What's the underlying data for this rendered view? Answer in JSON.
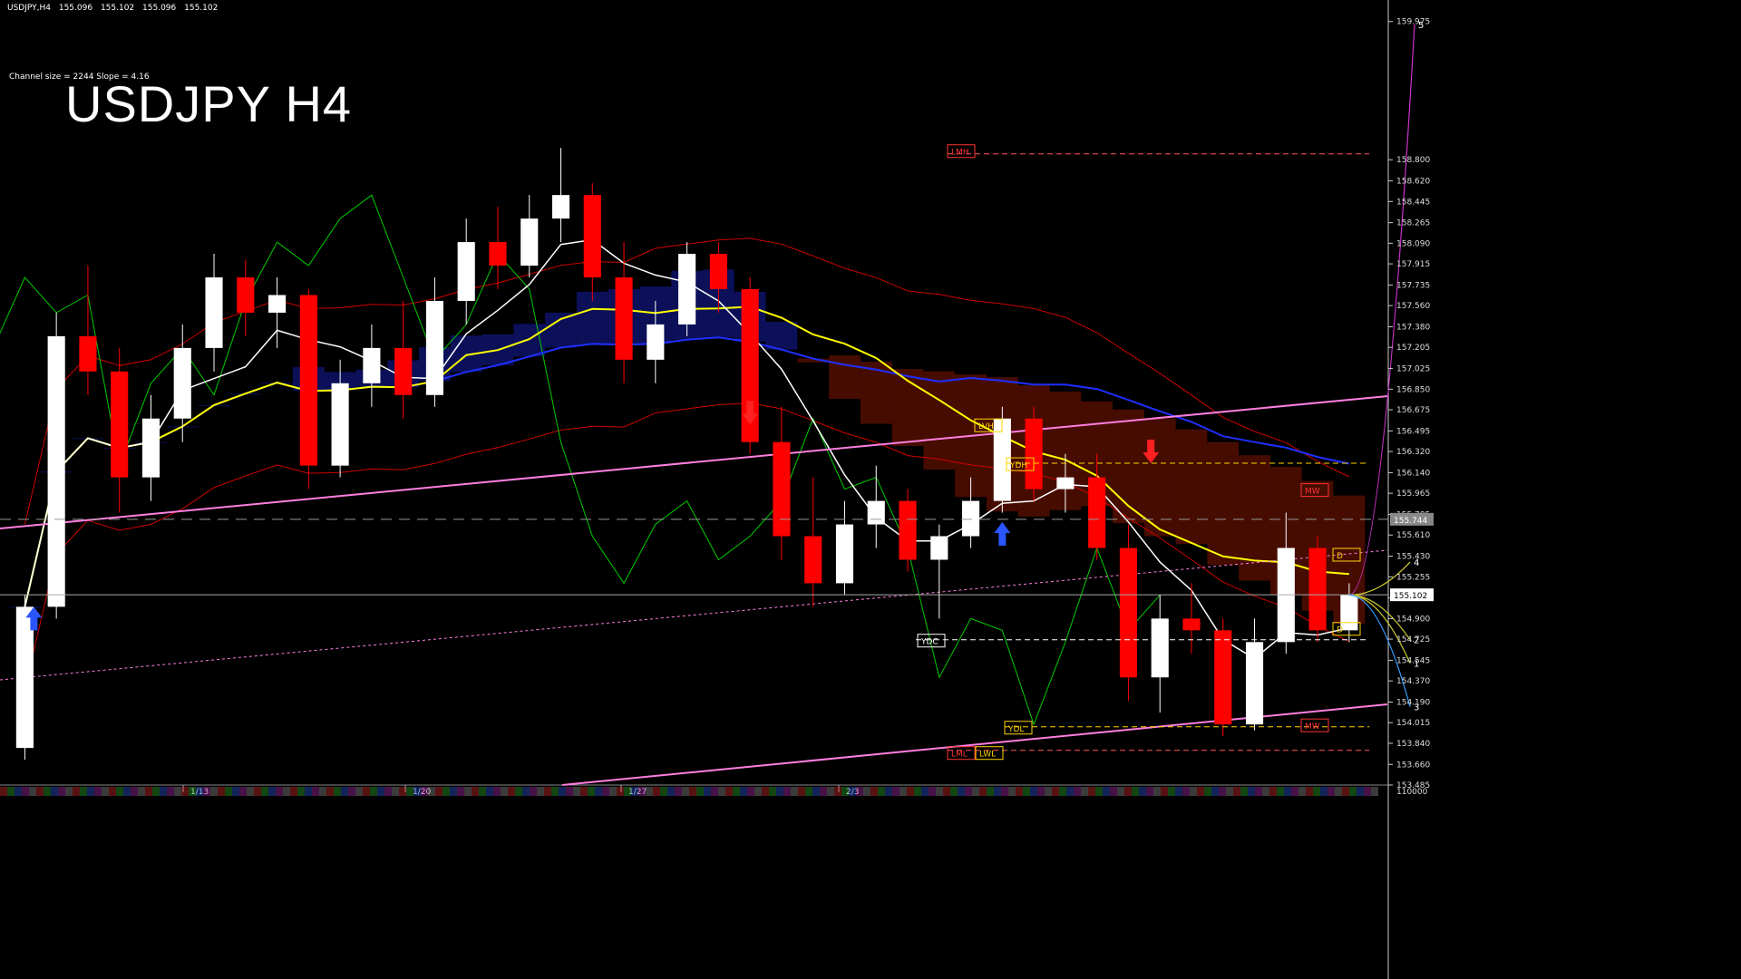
{
  "header": {
    "symbol": "USDJPY,H4",
    "quotes": [
      "155.096",
      "155.102",
      "155.096",
      "155.102"
    ]
  },
  "channel_info": "Channel size = 2244 Slope = 4.16",
  "big_title": "USDJPY H4",
  "colors": {
    "background": "#000000",
    "bull_candle": "#ffffff",
    "bear_candle": "#ff0000",
    "ma_slow": "#1f2fff",
    "ma_mid": "#ffff00",
    "ma_fast": "#ffffff",
    "channel": "#ff7fe0",
    "envelope": "#cc0000",
    "chikou": "#00cc00",
    "projection": "#cc33cc",
    "cloud_bull": "#1f2fff",
    "cloud_bear": "#cc2200",
    "level_yellow": "#ffd400"
  },
  "chart_data": {
    "type": "candlestick",
    "ylim": [
      153.485,
      160.05
    ],
    "y_ticks": [
      "159.975",
      "158.800",
      "158.620",
      "158.445",
      "158.265",
      "158.090",
      "157.915",
      "157.735",
      "157.560",
      "157.380",
      "157.205",
      "157.025",
      "156.850",
      "156.675",
      "156.495",
      "156.320",
      "156.140",
      "155.965",
      "155.785",
      "155.610",
      "155.430",
      "155.255",
      "155.075",
      "154.900",
      "154.725",
      "154.545",
      "154.370",
      "154.190",
      "154.015",
      "153.840",
      "153.660",
      "153.485"
    ],
    "x_labels": [
      "1/13",
      "1/20",
      "1/27",
      "2/3"
    ],
    "price_markers": {
      "current": "155.102",
      "dashed": "155.744"
    },
    "level_labels": [
      "LMH",
      "LVH",
      "YDH",
      "YDC",
      "YDL",
      "LML",
      "LWL",
      "MW",
      "MW",
      "D",
      "D"
    ],
    "projection_labels": [
      "5",
      "4",
      "2",
      "1",
      "3"
    ],
    "bottom_label": "110000",
    "candles": [
      [
        153.8,
        155.1,
        153.7,
        155.0
      ],
      [
        155.0,
        157.5,
        154.9,
        157.3
      ],
      [
        157.3,
        157.9,
        156.8,
        157.0
      ],
      [
        157.0,
        157.2,
        155.8,
        156.1
      ],
      [
        156.1,
        156.8,
        155.9,
        156.6
      ],
      [
        156.6,
        157.4,
        156.4,
        157.2
      ],
      [
        157.2,
        158.0,
        157.0,
        157.8
      ],
      [
        157.8,
        157.95,
        157.3,
        157.5
      ],
      [
        157.5,
        157.8,
        157.2,
        157.65
      ],
      [
        157.65,
        157.7,
        156.0,
        156.2
      ],
      [
        156.2,
        157.1,
        156.1,
        156.9
      ],
      [
        156.9,
        157.4,
        156.7,
        157.2
      ],
      [
        157.2,
        157.6,
        156.6,
        156.8
      ],
      [
        156.8,
        157.8,
        156.7,
        157.6
      ],
      [
        157.6,
        158.3,
        157.4,
        158.1
      ],
      [
        158.1,
        158.4,
        157.7,
        157.9
      ],
      [
        157.9,
        158.5,
        157.8,
        158.3
      ],
      [
        158.3,
        158.9,
        158.1,
        158.5
      ],
      [
        158.5,
        158.6,
        157.6,
        157.8
      ],
      [
        157.8,
        158.1,
        156.9,
        157.1
      ],
      [
        157.1,
        157.6,
        156.9,
        157.4
      ],
      [
        157.4,
        158.1,
        157.3,
        158.0
      ],
      [
        158.0,
        158.1,
        157.5,
        157.7
      ],
      [
        157.7,
        157.8,
        156.3,
        156.4
      ],
      [
        156.4,
        156.7,
        155.4,
        155.6
      ],
      [
        155.6,
        156.1,
        155.0,
        155.2
      ],
      [
        155.2,
        155.9,
        155.1,
        155.7
      ],
      [
        155.7,
        156.2,
        155.5,
        155.9
      ],
      [
        155.9,
        156.0,
        155.3,
        155.4
      ],
      [
        155.4,
        155.7,
        154.9,
        155.6
      ],
      [
        155.6,
        156.1,
        155.5,
        155.9
      ],
      [
        155.9,
        156.7,
        155.8,
        156.6
      ],
      [
        156.6,
        156.7,
        155.9,
        156.0
      ],
      [
        156.0,
        156.3,
        155.8,
        156.1
      ],
      [
        156.1,
        156.3,
        155.4,
        155.5
      ],
      [
        155.5,
        155.7,
        154.2,
        154.4
      ],
      [
        154.4,
        155.1,
        154.1,
        154.9
      ],
      [
        154.9,
        155.2,
        154.6,
        154.8
      ],
      [
        154.8,
        154.9,
        153.9,
        154.0
      ],
      [
        154.0,
        154.9,
        153.95,
        154.7
      ],
      [
        154.7,
        155.8,
        154.6,
        155.5
      ],
      [
        155.5,
        155.6,
        154.7,
        154.8
      ],
      [
        154.8,
        155.2,
        154.7,
        155.1
      ]
    ]
  }
}
